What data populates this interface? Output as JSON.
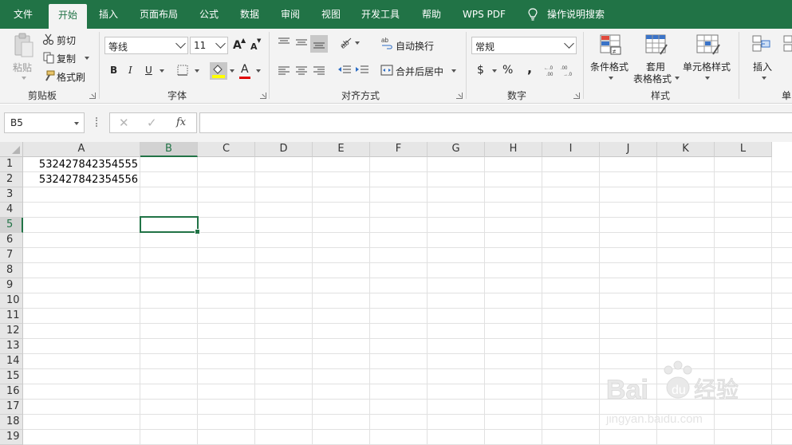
{
  "menu": {
    "tabs": [
      {
        "label": "文件"
      },
      {
        "label": "开始"
      },
      {
        "label": "插入"
      },
      {
        "label": "页面布局"
      },
      {
        "label": "公式"
      },
      {
        "label": "数据"
      },
      {
        "label": "审阅"
      },
      {
        "label": "视图"
      },
      {
        "label": "开发工具"
      },
      {
        "label": "帮助"
      },
      {
        "label": "WPS PDF"
      }
    ],
    "active_tab": "开始",
    "tell_me": "操作说明搜索"
  },
  "ribbon": {
    "clipboard": {
      "paste": "粘贴",
      "cut": "剪切",
      "copy": "复制",
      "format_painter": "格式刷",
      "group": "剪贴板"
    },
    "font": {
      "font_name": "等线",
      "font_size": "11",
      "bold": "B",
      "italic": "I",
      "underline": "U",
      "font_color_letter": "A",
      "grow": "A",
      "shrink": "A",
      "group": "字体"
    },
    "alignment": {
      "wrap": "自动换行",
      "merge": "合并后居中",
      "group": "对齐方式"
    },
    "number": {
      "format": "常规",
      "currency": "$",
      "percent": "%",
      "comma": ",",
      "group": "数字"
    },
    "styles": {
      "conditional": "条件格式",
      "table_line1": "套用",
      "table_line2": "表格格式",
      "cell_styles": "单元格样式",
      "group": "样式"
    },
    "cells": {
      "insert": "插入",
      "group_partial": "单"
    }
  },
  "formula_bar": {
    "name_box": "B5",
    "cancel": "✕",
    "enter": "✓",
    "fx": "fx",
    "content": ""
  },
  "sheet": {
    "columns": [
      "A",
      "B",
      "C",
      "D",
      "E",
      "F",
      "G",
      "H",
      "I",
      "J",
      "K",
      "L"
    ],
    "rows": [
      "1",
      "2",
      "3",
      "4",
      "5",
      "6",
      "7",
      "8",
      "9",
      "10",
      "11",
      "12",
      "13",
      "14",
      "15",
      "16",
      "17",
      "18",
      "19"
    ],
    "selected_column": "B",
    "selected_row": "5",
    "cells": {
      "A1": "532427842354555",
      "A2": "532427842354556"
    }
  },
  "colors": {
    "accent": "#217346",
    "ribbon_bg": "#f3f3f3",
    "grid_line": "#e1e1e1"
  }
}
